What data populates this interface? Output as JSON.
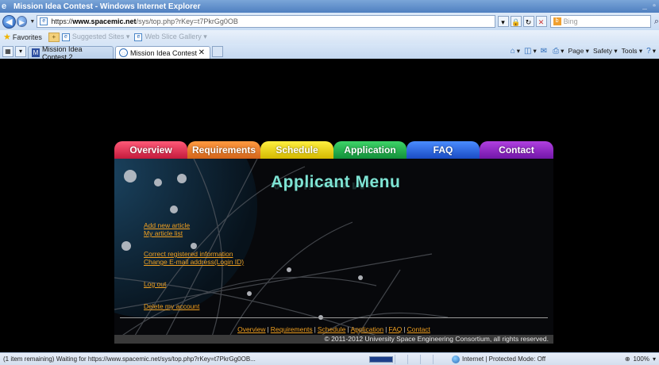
{
  "window": {
    "title": "Mission Idea Contest - Windows Internet Explorer"
  },
  "address_bar": {
    "url_proto": "https://",
    "url_host": "www.spacemic.net",
    "url_path": "/sys/top.php?rKey=t7PkrGg0OB",
    "search_placeholder": "Bing"
  },
  "favorites_bar": {
    "favorites_label": "Favorites",
    "items": [
      "Suggested Sites ▾",
      "Web Slice Gallery ▾"
    ]
  },
  "tabs": [
    {
      "label": "Mission Idea Contest 2",
      "active": false
    },
    {
      "label": "Mission Idea Contest",
      "active": true
    }
  ],
  "command_bar": {
    "page": "Page ▾",
    "safety": "Safety ▾",
    "tools": "Tools ▾"
  },
  "site": {
    "nav": [
      "Overview",
      "Requirements",
      "Schedule",
      "Application",
      "FAQ",
      "Contact"
    ],
    "panel_title": "Applicant Menu",
    "links": {
      "add_article": "Add new article",
      "my_articles": "My article list",
      "correct_info": "Correct registered information",
      "change_email": "Change E-mail address(Login ID)",
      "log_out": "Log out",
      "delete_account": "Delete my account"
    },
    "footer_links": [
      "Overview",
      "Requirements",
      "Schedule",
      "Application",
      "FAQ",
      "Contact"
    ],
    "copyright": "© 2011-2012 University Space Engineering Consortium, all rights reserved."
  },
  "status_bar": {
    "message": "(1 item remaining) Waiting for https://www.spacemic.net/sys/top.php?rKey=t7PkrGg0OB...",
    "zone": "Internet | Protected Mode: Off",
    "zoom": "100%"
  }
}
